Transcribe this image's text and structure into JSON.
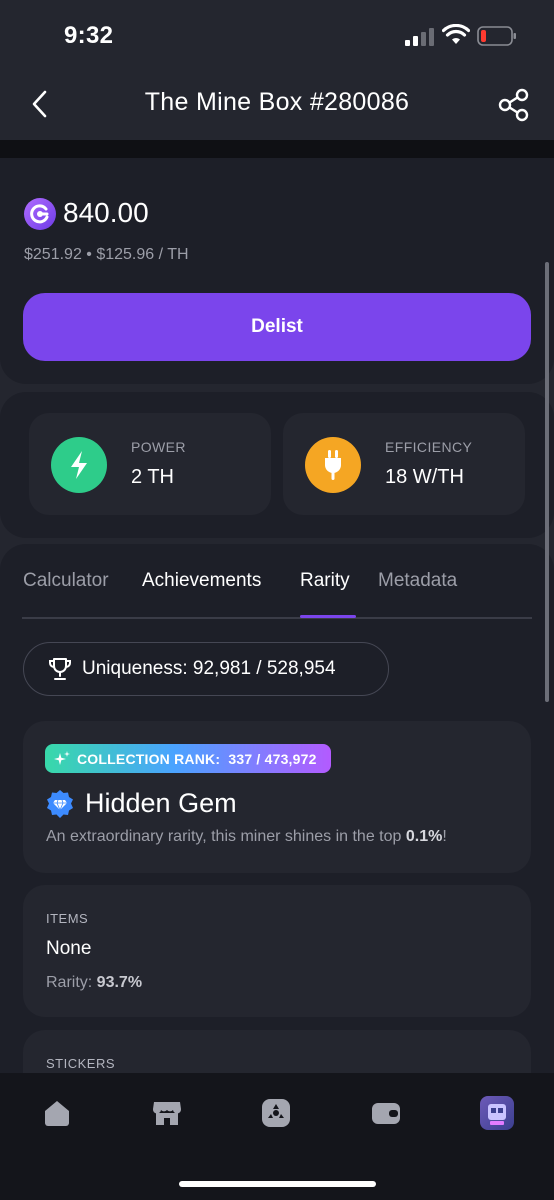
{
  "status_bar": {
    "time": "9:32"
  },
  "header": {
    "title": "The Mine Box #280086"
  },
  "price": {
    "amount": "840.00",
    "subtitle": "$251.92 • $125.96 / TH",
    "action_label": "Delist"
  },
  "stats": {
    "power": {
      "label": "POWER",
      "value": "2 TH"
    },
    "efficiency": {
      "label": "EFFICIENCY",
      "value": "18 W/TH"
    }
  },
  "tabs": [
    {
      "label": "Calculator",
      "active": false
    },
    {
      "label": "Achievements",
      "active": false
    },
    {
      "label": "Rarity",
      "active": true
    },
    {
      "label": "Metadata",
      "active": false
    }
  ],
  "uniqueness": {
    "text": "Uniqueness: 92,981 / 528,954"
  },
  "rank": {
    "badge_label": "COLLECTION RANK:",
    "badge_value": "337 / 473,972",
    "title": "Hidden Gem",
    "description": "An extraordinary rarity, this miner shines in the top ",
    "description_value": "0.1%",
    "description_end": "!"
  },
  "items": {
    "label": "ITEMS",
    "value": "None",
    "rarity_label": "Rarity: ",
    "rarity_value": "93.7%"
  },
  "stickers": {
    "label": "STICKERS"
  },
  "colors": {
    "accent": "#7b45ec",
    "power": "#2ecc8a",
    "efficiency": "#f5a623"
  },
  "bottom_nav": [
    "home-icon",
    "store-icon",
    "miners-icon",
    "wallet-icon",
    "profile-avatar"
  ]
}
